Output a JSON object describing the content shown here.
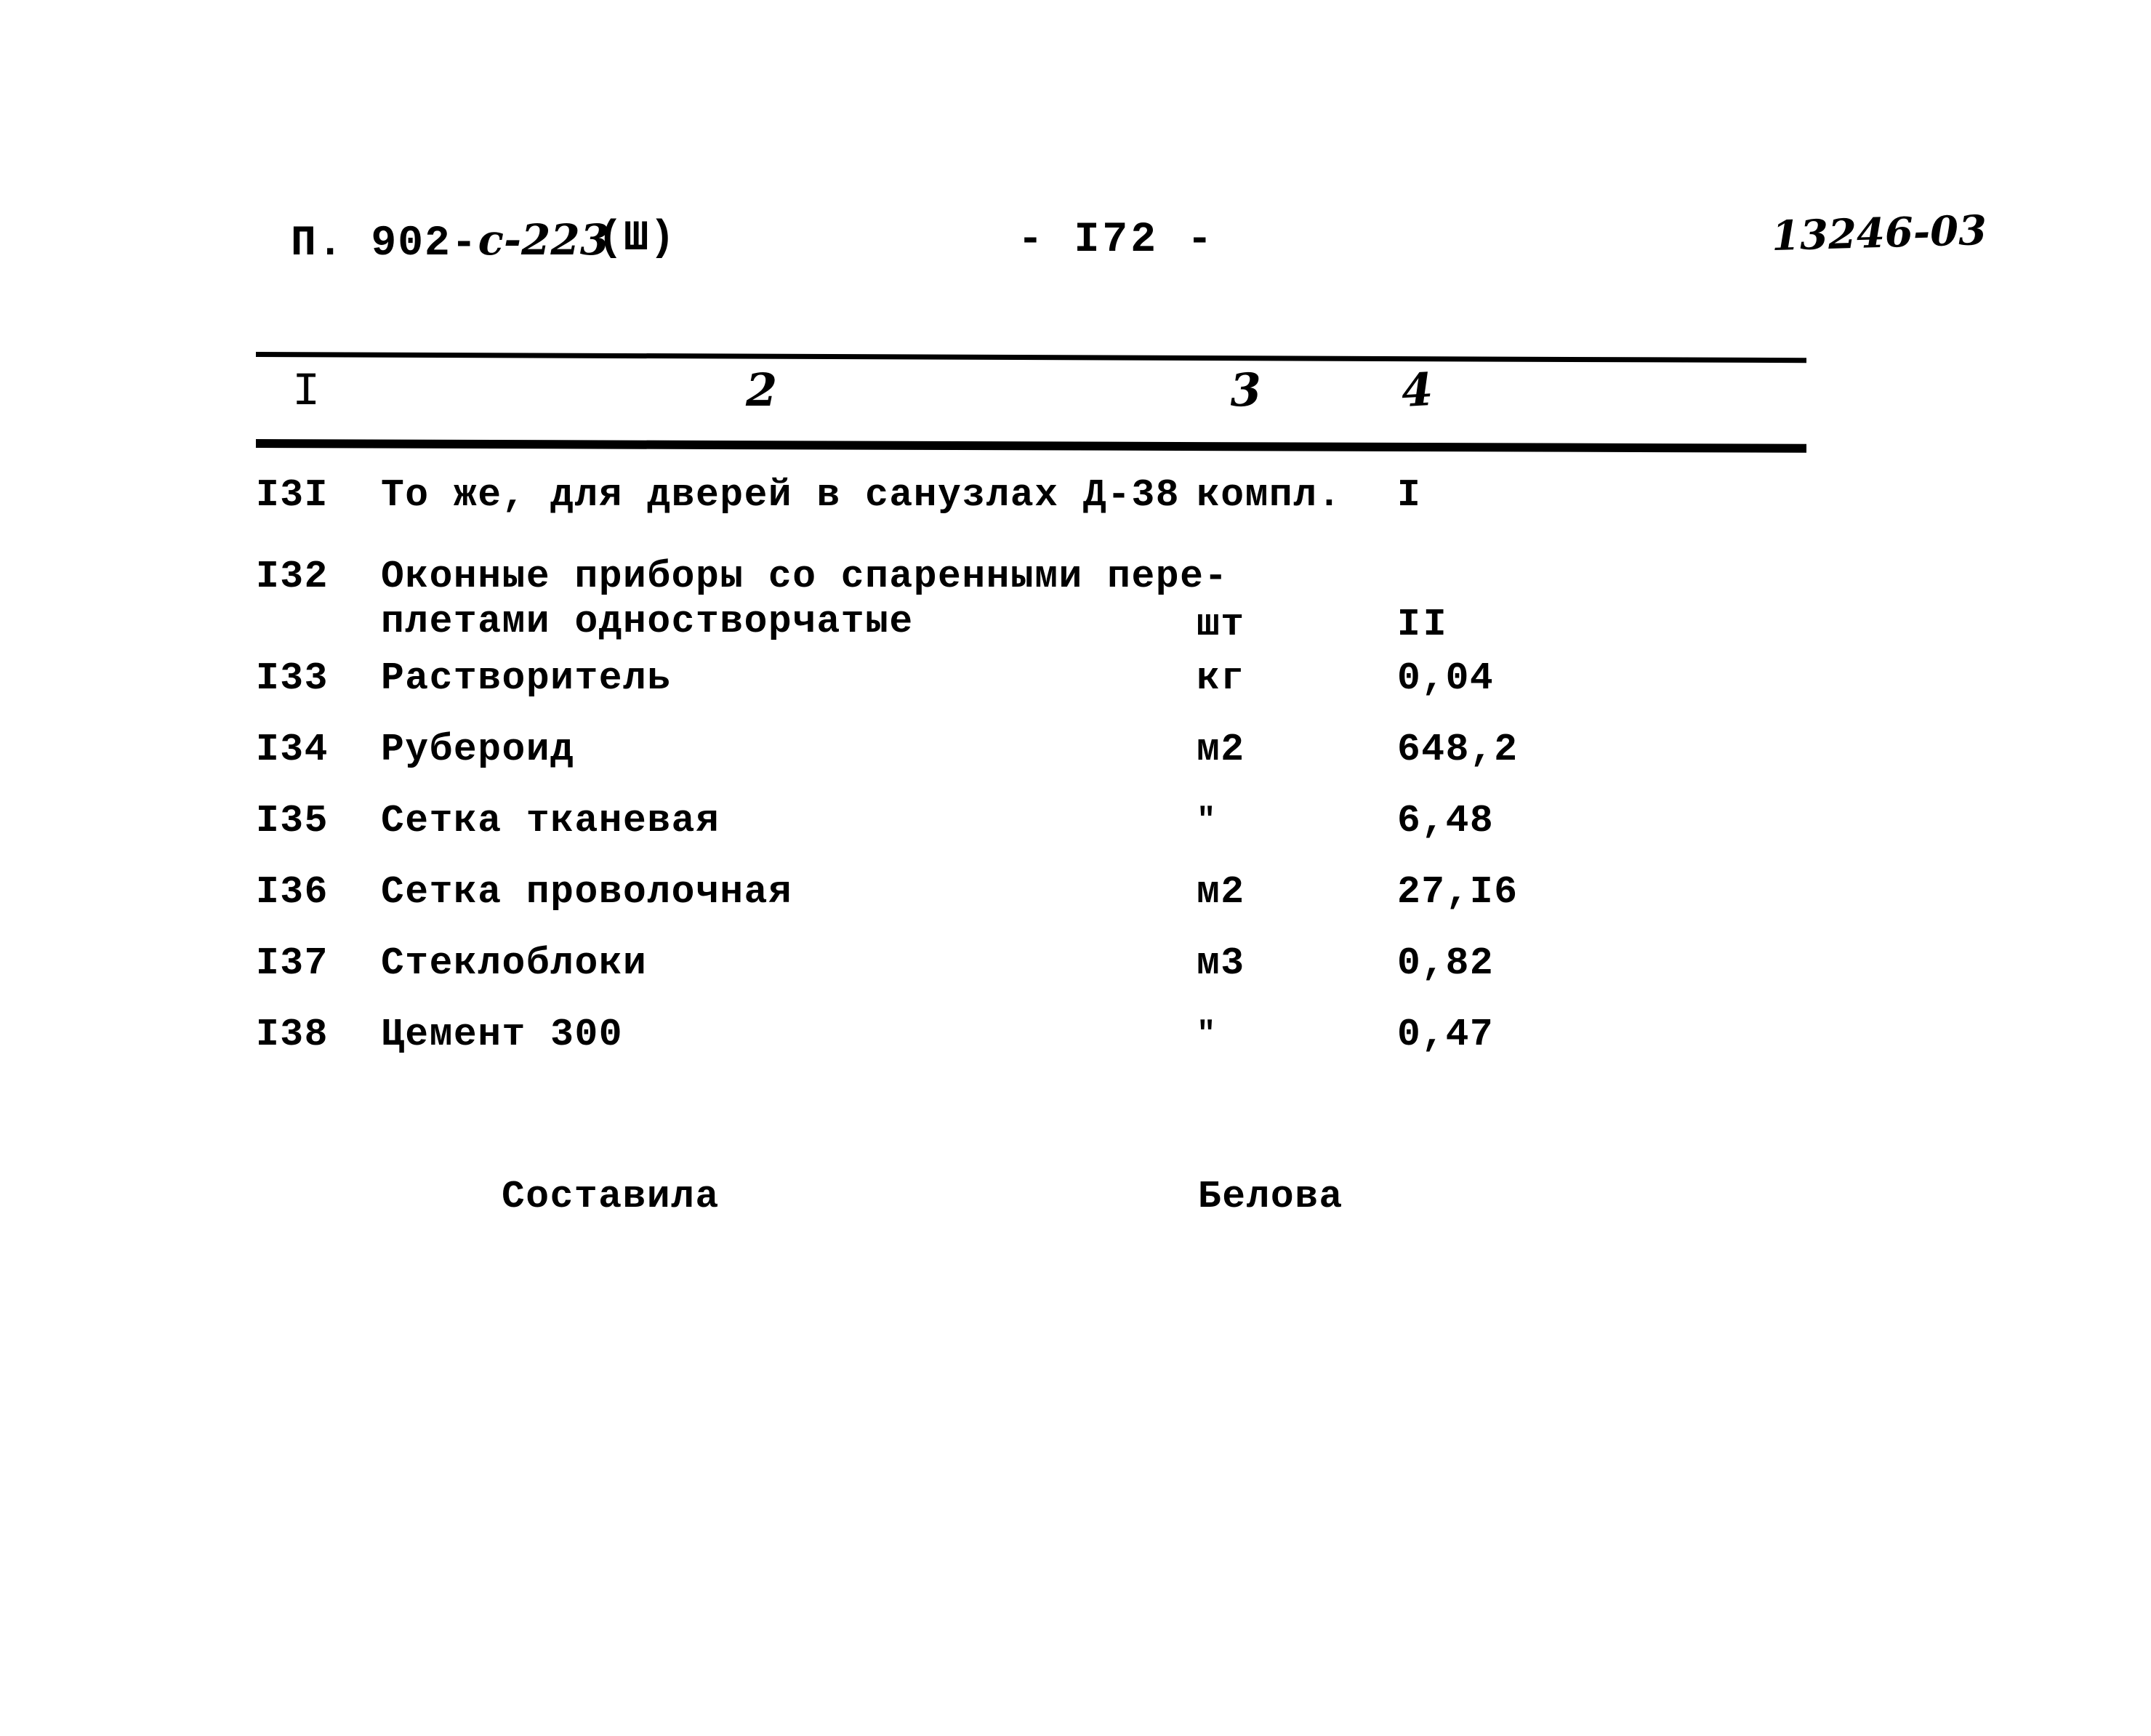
{
  "header": {
    "doc_code_prefix": "П. 902-",
    "doc_code_hand": "с-223",
    "doc_section": "(Ш)",
    "page_number": "- I72 -",
    "stamp_code": "13246-03"
  },
  "table": {
    "column_headers": [
      "I",
      "2",
      "3",
      "4"
    ],
    "rows": [
      {
        "num": "I3I",
        "desc_line1": "То же, для дверей в санузлах Д-38",
        "desc_line2": "",
        "unit": "компл.",
        "qty": "I"
      },
      {
        "num": "I32",
        "desc_line1": "Оконные приборы со спаренными пере-",
        "desc_line2": "плетами одностворчатые",
        "unit": "шт",
        "qty": "II"
      },
      {
        "num": "I33",
        "desc_line1": "Растворитель",
        "desc_line2": "",
        "unit": "кг",
        "qty": "0,04"
      },
      {
        "num": "I34",
        "desc_line1": "Рубероид",
        "desc_line2": "",
        "unit": "м2",
        "qty": "648,2"
      },
      {
        "num": "I35",
        "desc_line1": "Сетка тканевая",
        "desc_line2": "",
        "unit": "\"",
        "qty": "6,48"
      },
      {
        "num": "I36",
        "desc_line1": "Сетка проволочная",
        "desc_line2": "",
        "unit": "м2",
        "qty": "27,I6"
      },
      {
        "num": "I37",
        "desc_line1": "Стеклоблоки",
        "desc_line2": "",
        "unit": "м3",
        "qty": "0,82"
      },
      {
        "num": "I38",
        "desc_line1": "Цемент 300",
        "desc_line2": "",
        "unit": "\"",
        "qty": "0,47"
      }
    ]
  },
  "signature": {
    "role": "Составила",
    "name": "Белова"
  }
}
